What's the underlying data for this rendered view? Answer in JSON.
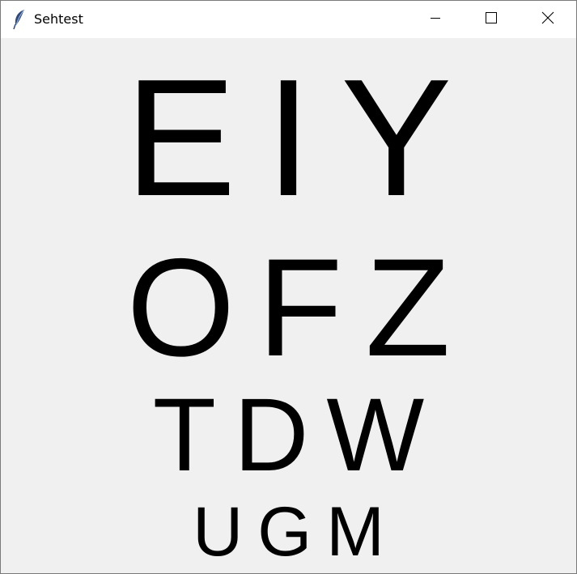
{
  "window": {
    "title": "Sehtest",
    "icon": "feather-icon",
    "controls": [
      "minimize-icon",
      "maximize-icon",
      "close-icon"
    ]
  },
  "chart_rows": [
    [
      "E",
      "I",
      "Y"
    ],
    [
      "O",
      "F",
      "Z"
    ],
    [
      "T",
      "D",
      "W"
    ],
    [
      "U",
      "G",
      "M"
    ]
  ]
}
